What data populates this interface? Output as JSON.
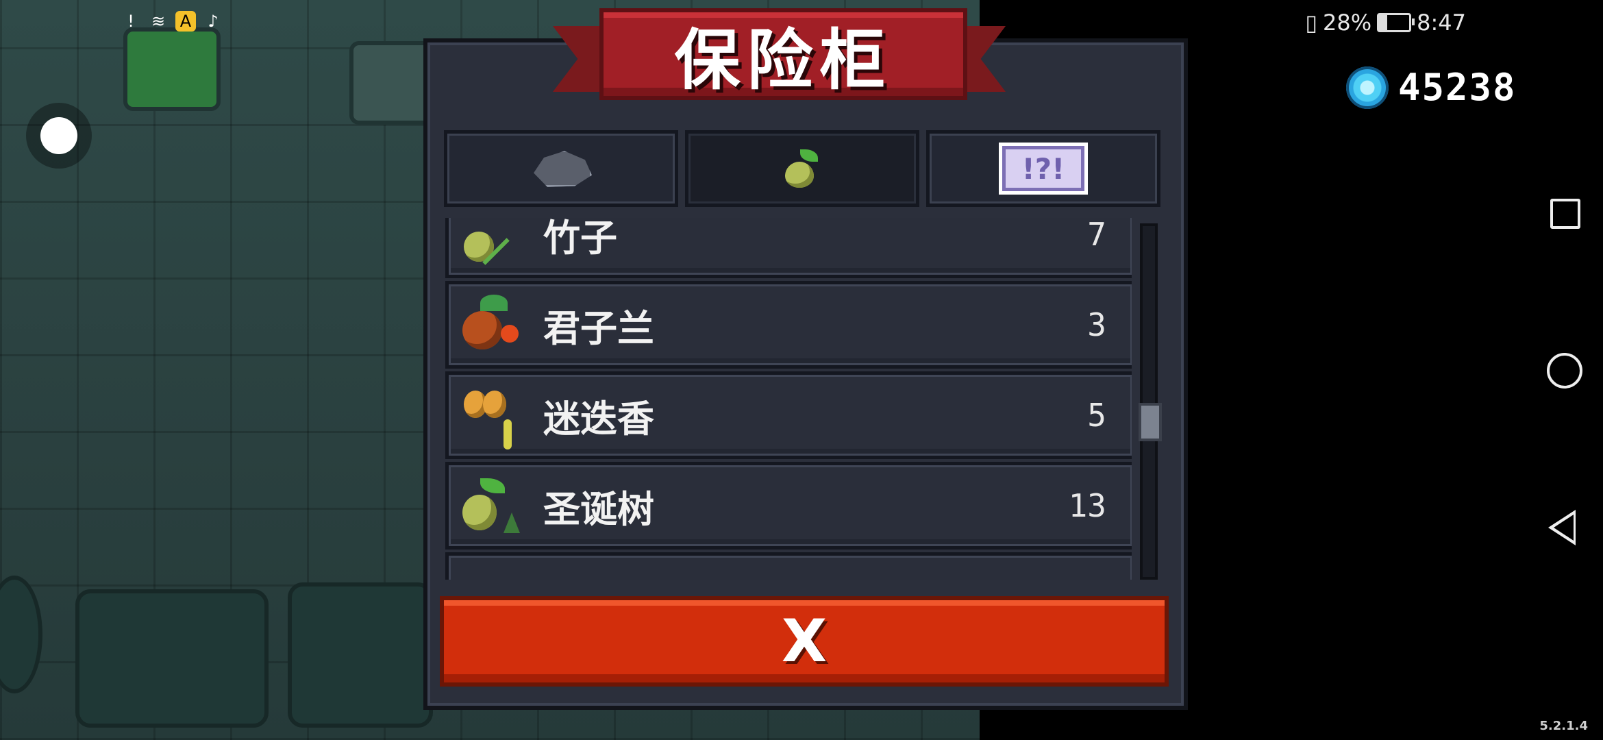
{
  "status_bar": {
    "battery": "28%",
    "time": "8:47",
    "icons": [
      "alert-icon",
      "wifi-icon",
      "app-yellow-icon",
      "tiktok-icon"
    ]
  },
  "gems": {
    "count": "45238",
    "icon": "blue-gem-icon"
  },
  "dialog": {
    "title": "保险柜",
    "tabs": [
      {
        "icon": "ore-icon",
        "active": false
      },
      {
        "icon": "seed-icon",
        "active": true
      },
      {
        "icon": "ticket-icon",
        "label": "!?!",
        "active": false
      }
    ],
    "items": [
      {
        "name": "竹子",
        "count": "7",
        "icon": "bamboo-seed-icon"
      },
      {
        "name": "君子兰",
        "count": "3",
        "icon": "clivia-icon"
      },
      {
        "name": "迷迭香",
        "count": "5",
        "icon": "rosemary-icon"
      },
      {
        "name": "圣诞树",
        "count": "13",
        "icon": "christmas-tree-seed-icon"
      }
    ],
    "close_label": "X"
  },
  "version": "5.2.1.4"
}
